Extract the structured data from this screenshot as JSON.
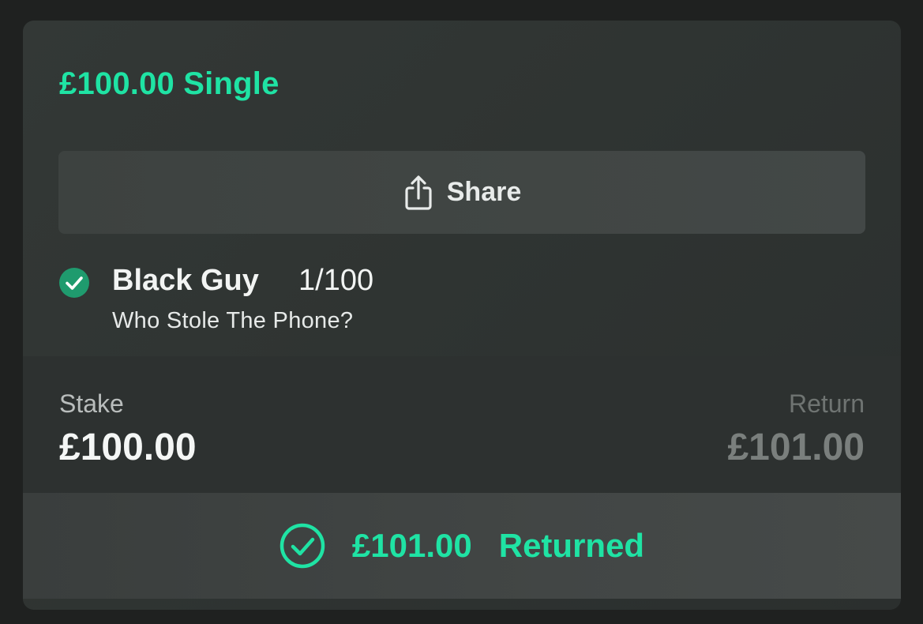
{
  "bet": {
    "title": "£100.00 Single"
  },
  "share": {
    "label": "Share",
    "icon": "share-icon"
  },
  "selection": {
    "status_icon": "check-circle-icon",
    "name": "Black Guy",
    "odds": "1/100",
    "market": "Who Stole The Phone?"
  },
  "stake": {
    "label": "Stake",
    "value": "£100.00"
  },
  "return": {
    "label": "Return",
    "value": "£101.00"
  },
  "result": {
    "icon": "check-circle-outline-icon",
    "amount": "£101.00",
    "label": "Returned"
  },
  "colors": {
    "accent": "#1fe3a4",
    "win_check": "#1f9b6e",
    "card_background": "#313634"
  }
}
